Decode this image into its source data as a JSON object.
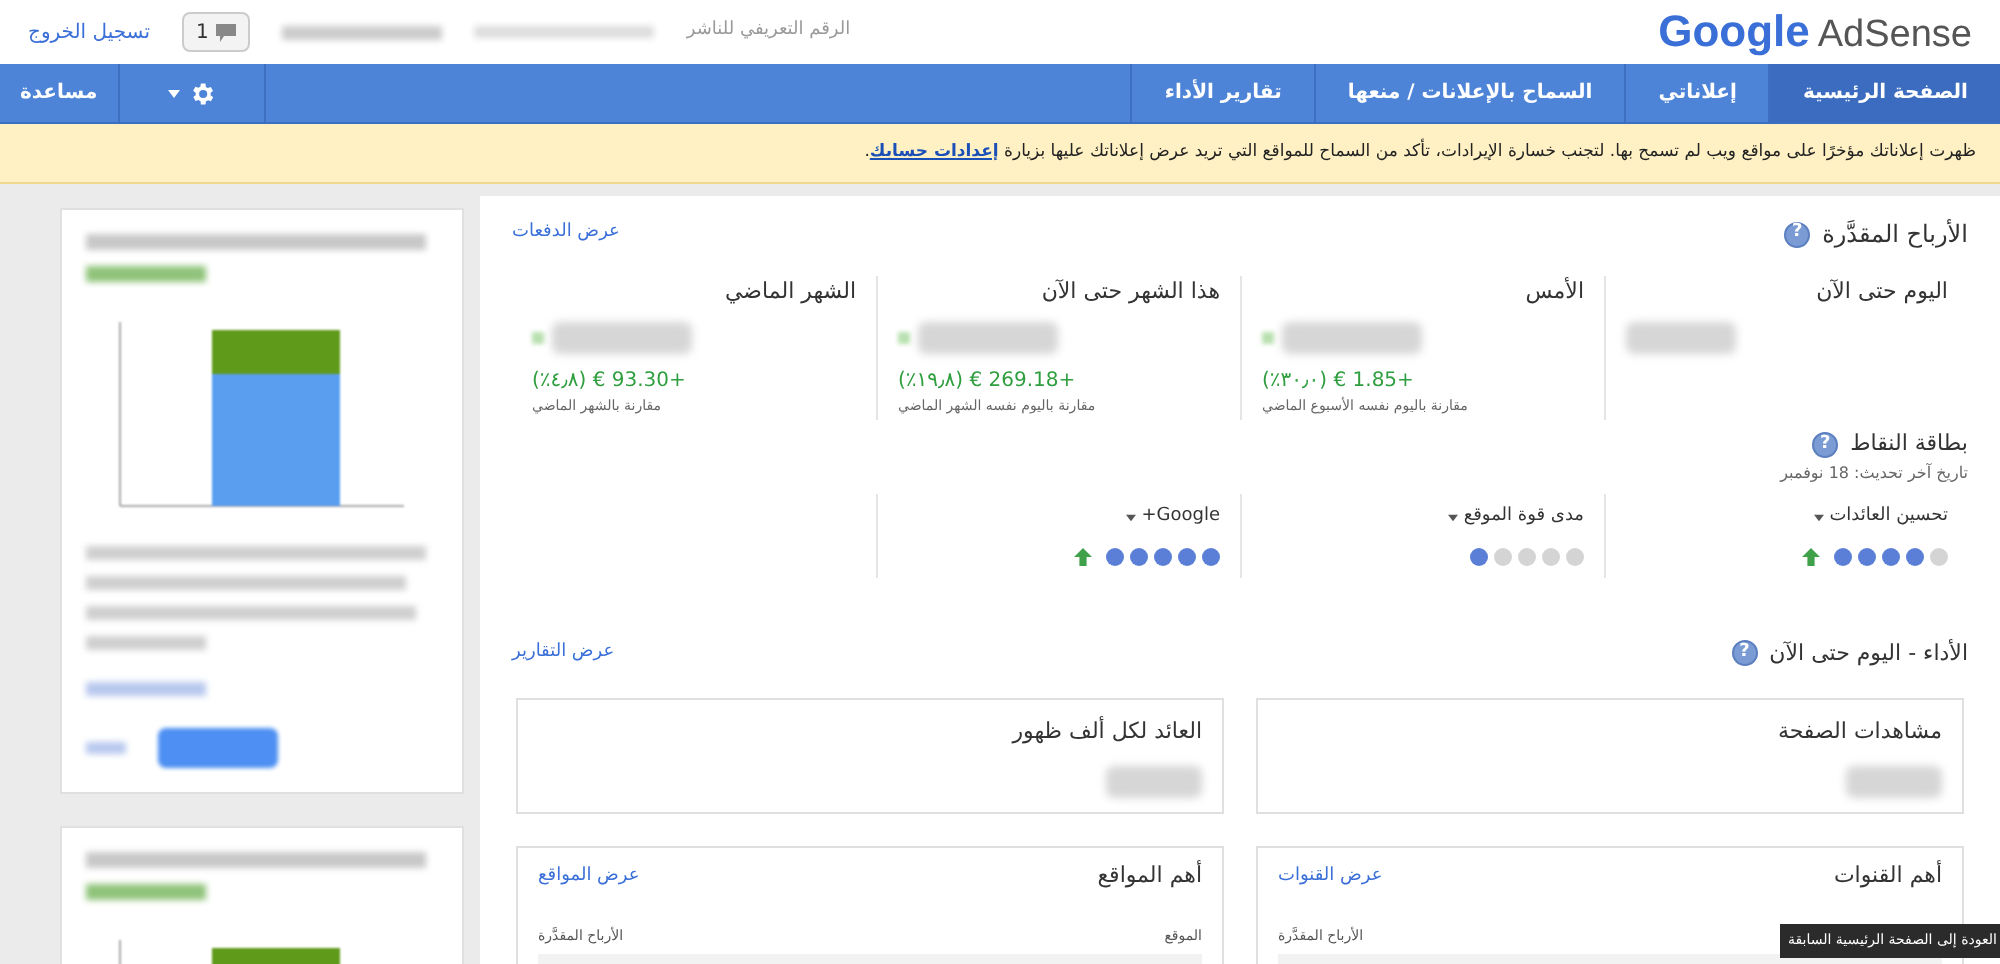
{
  "header": {
    "logo_google": "Google",
    "logo_product": "AdSense",
    "publisher_id_label": "الرقم التعريفي للناشر",
    "notifications_count": "1",
    "sign_out": "تسجيل الخروج"
  },
  "nav": {
    "tabs": [
      {
        "label": "الصفحة الرئيسية",
        "selected": true
      },
      {
        "label": "إعلاناتي",
        "selected": false
      },
      {
        "label": "السماح بالإعلانات / منعها",
        "selected": false
      },
      {
        "label": "تقارير الأداء",
        "selected": false
      }
    ],
    "help": "مساعدة"
  },
  "notice": {
    "text": "ظهرت إعلاناتك مؤخرًا على مواقع ويب لم تسمح بها. لتجنب خسارة الإيرادات، تأكد من السماح للمواقع التي تريد عرض إعلاناتك عليها بزيارة",
    "link": "إعدادات حسابك",
    "suffix": "."
  },
  "help_glyph": "?",
  "earnings": {
    "title": "الأرباح المقدَّرة",
    "link": "عرض الدفعات",
    "columns": [
      {
        "label": "اليوم حتى الآن"
      },
      {
        "label": "الأمس",
        "change": "+1.85 € (٣٠٫٠٪)",
        "comparison": "مقارنة باليوم نفسه الأسبوع الماضي"
      },
      {
        "label": "هذا الشهر حتى الآن",
        "change": "+269.18 € (١٩٫٨٪)",
        "comparison": "مقارنة باليوم نفسه الشهر الماضي"
      },
      {
        "label": "الشهر الماضي",
        "change": "+93.30 € (٤٫٨٪)",
        "comparison": "مقارنة بالشهر الماضي"
      }
    ]
  },
  "scorecard": {
    "title": "بطاقة النقاط",
    "updated": "تاريخ آخر تحديث: 18 نوفمبر",
    "items": [
      {
        "label": "تحسين العائدات",
        "stars": 4,
        "trend_up": true
      },
      {
        "label": "مدى قوة الموقع",
        "stars": 1,
        "trend_up": false
      },
      {
        "label": "Google+",
        "stars": 5,
        "trend_up": true
      }
    ]
  },
  "performance": {
    "title": "الأداء - اليوم حتى الآن",
    "link": "عرض التقارير",
    "metrics": [
      {
        "label": "مشاهدات الصفحة"
      },
      {
        "label": "العائد لكل ألف ظهور"
      }
    ],
    "tables": [
      {
        "title": "أهم القنوات",
        "link": "عرض القنوات",
        "columns": [
          "الأرباح المقدَّرة"
        ]
      },
      {
        "title": "أهم المواقع",
        "link": "عرض المواقع",
        "columns": [
          "الموقع",
          "الأرباح المقدَّرة"
        ]
      }
    ]
  },
  "tooltip": "العودة إلى الصفحة الرئيسية السابقة"
}
